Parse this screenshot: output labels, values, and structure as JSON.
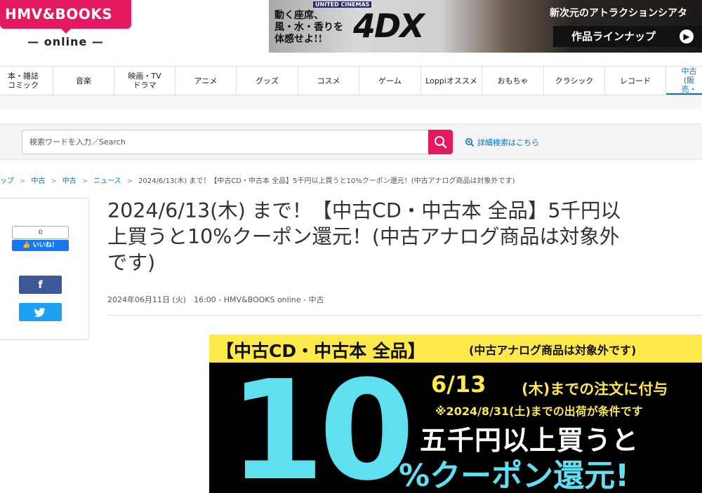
{
  "logo": {
    "brand": "HMV&BOOKS",
    "sub": "— online —"
  },
  "banner": {
    "cinema": "UNITED CINEMAS",
    "copy_line1": "動く座席、",
    "copy_line2": "風・水・香りを",
    "copy_line3": "体感せよ!!",
    "product": "4DX",
    "headline": "新次元のアトラクションシアタ",
    "button_label": "作品ラインナップ"
  },
  "nav": {
    "categories": [
      {
        "label": "本・雑誌\nコミック"
      },
      {
        "label": "音楽"
      },
      {
        "label": "映画・TV\nドラマ"
      },
      {
        "label": "アニメ"
      },
      {
        "label": "グッズ"
      },
      {
        "label": "コスメ"
      },
      {
        "label": "ゲーム"
      },
      {
        "label": "Loppiオススメ"
      },
      {
        "label": "おもちゃ"
      },
      {
        "label": "クラシック"
      },
      {
        "label": "レコード"
      },
      {
        "label": "中古\n(販売・"
      }
    ]
  },
  "search": {
    "placeholder": "検索ワードを入力／Search",
    "advanced_label": "詳細検索はこちら"
  },
  "breadcrumb": {
    "items": [
      "ップ",
      "中古",
      "中古",
      "ニュース"
    ],
    "current": "2024/6/13(木) まで！【中古CD・中古本 全品】5千円以上買うと10%クーポン還元！(中古アナログ商品は対象外です)"
  },
  "share": {
    "like_count": "0",
    "like_label": "いいね！",
    "facebook_label": "f"
  },
  "article": {
    "title_line1": "2024/6/13(木) まで！【中古CD・中古本 全品】5千円以",
    "title_line2": "上買うと10%クーポン還元！(中古アナログ商品は対象外",
    "title_line3": "です)",
    "meta": "2024年06月11日 (火)　16:00 - HMV&BOOKS online - 中古"
  },
  "promo": {
    "top_big": "【中古CD・中古本 全品】",
    "top_small": "(中古アナログ商品は対象外です)",
    "big_number": "10",
    "date": "6/13",
    "date_suffix": "(木)までの注文に付与",
    "condition": "※2024/8/31(土)までの出荷が条件です",
    "line1": "五千円以上買うと",
    "line2": "%クーポン還元!"
  },
  "colors": {
    "brand": "#e5195f",
    "link": "#0a72c0",
    "promo_yellow": "#ffe94a",
    "promo_cyan": "#5ee0f0"
  }
}
